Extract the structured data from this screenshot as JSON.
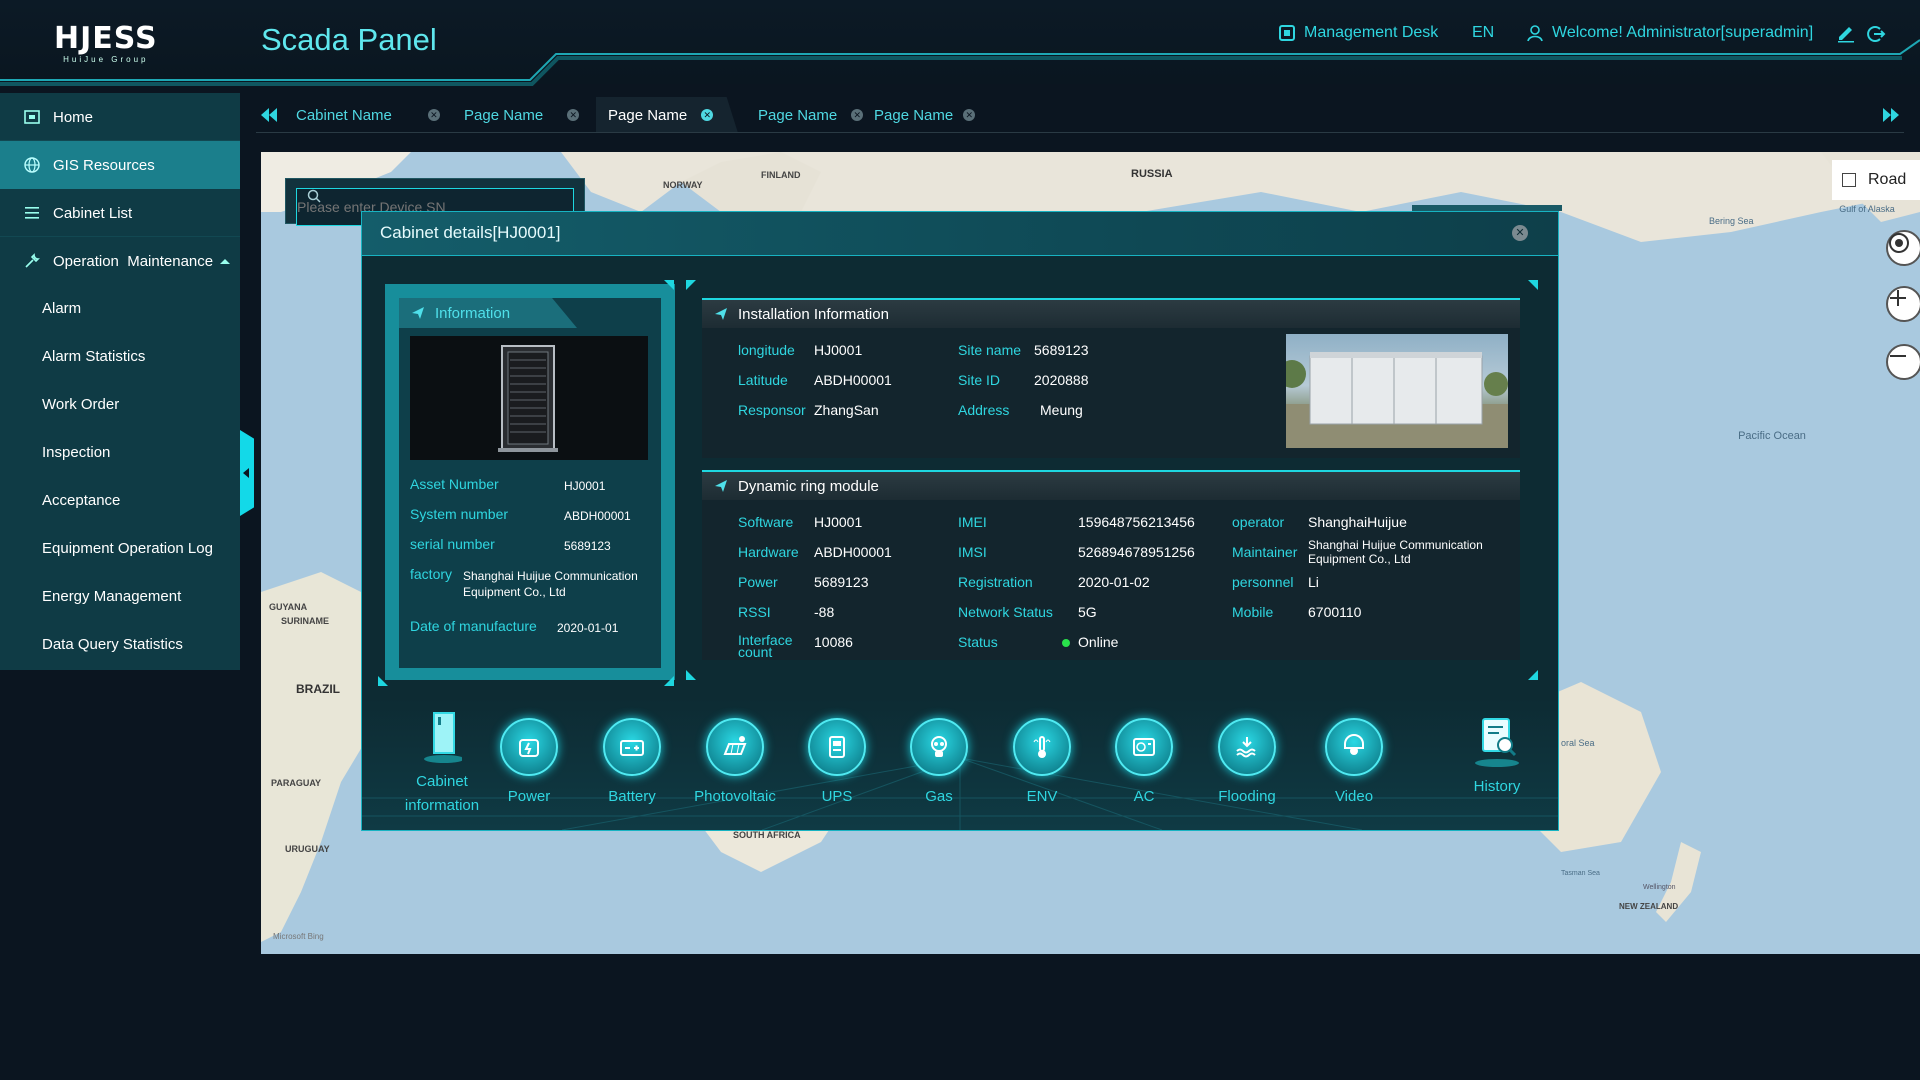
{
  "header": {
    "logo": "HJESS",
    "logo_sub": "HuiJue Group",
    "title": "Scada Panel",
    "management": "Management Desk",
    "lang": "EN",
    "welcome": "Welcome! Administrator[superadmin]"
  },
  "sidebar": {
    "items": [
      {
        "label": "Home",
        "icon": "home-icon"
      },
      {
        "label": "GIS Resources",
        "icon": "globe-icon"
      },
      {
        "label": "Cabinet List",
        "icon": "list-icon"
      },
      {
        "label": "Operation  Maintenance",
        "icon": "wrench-icon"
      }
    ],
    "sub_items": [
      "Alarm",
      "Alarm Statistics",
      "Work Order",
      "Inspection",
      "Acceptance",
      "Equipment Operation Log",
      "Energy Management",
      "Data Query Statistics"
    ]
  },
  "tabs": [
    {
      "label": "Cabinet Name",
      "active": false
    },
    {
      "label": "Page Name",
      "active": false
    },
    {
      "label": "Page Name",
      "active": true
    },
    {
      "label": "Page Name",
      "active": false
    },
    {
      "label": "Page Name",
      "active": false
    }
  ],
  "map": {
    "search_placeholder": "Please enter Device SN",
    "road_label": "Road",
    "labels": {
      "russia": "RUSSIA",
      "finland": "FINLAND",
      "norway": "NORWAY",
      "bering": "Bering Sea",
      "alaska": "Gulf of Alaska",
      "pacific": "Pacific Ocean",
      "guyana": "GUYANA",
      "suriname": "SURINAME",
      "brazil": "BRAZIL",
      "paraguay": "PARAGUAY",
      "uruguay": "URUGUAY",
      "south_africa": "SOUTH AFRICA",
      "coral": "oral Sea",
      "tasman": "Tasman Sea",
      "wellington": "Wellington",
      "nz": "NEW ZEALAND",
      "bing": "Microsoft Bing"
    }
  },
  "dialog": {
    "title": "Cabinet details[HJ0001]",
    "info": {
      "tab": "Information",
      "rows": [
        {
          "label": "Asset Number",
          "value": "HJ0001"
        },
        {
          "label": "System number",
          "value": "ABDH00001"
        },
        {
          "label": "serial number",
          "value": "5689123"
        },
        {
          "label": "factory",
          "value": "Shanghai Huijue Communication Equipment Co., Ltd"
        },
        {
          "label": "Date of manufacture",
          "value": "2020-01-01"
        }
      ]
    },
    "installation": {
      "title": "Installation Information",
      "fields": {
        "longitude_label": "longitude",
        "longitude": "HJ0001",
        "latitude_label": "Latitude",
        "latitude": "ABDH00001",
        "responsor_label": "Responsor",
        "responsor": "ZhangSan",
        "site_name_label": "Site name",
        "site_name": "5689123",
        "site_id_label": "Site ID",
        "site_id": "2020888",
        "address_label": "Address",
        "address": "Meung"
      }
    },
    "ring": {
      "title": "Dynamic ring module",
      "fields": {
        "software_label": "Software",
        "software": "HJ0001",
        "hardware_label": "Hardware",
        "hardware": "ABDH00001",
        "power_label": "Power",
        "power": "5689123",
        "rssi_label": "RSSI",
        "rssi": "-88",
        "interface_label": "Interface count",
        "interface": "10086",
        "imei_label": "IMEI",
        "imei": "159648756213456",
        "imsi_label": "IMSI",
        "imsi": "526894678951256",
        "registration_label": "Registration",
        "registration": "2020-01-02",
        "network_label": "Network Status",
        "network": "5G",
        "status_label": "Status",
        "status": "Online",
        "operator_label": "operator",
        "operator": "ShanghaiHuijue",
        "maintainer_label": "Maintainer",
        "maintainer": "Shanghai Huijue Communication Equipment Co., Ltd",
        "personnel_label": "personnel",
        "personnel": "Li",
        "mobile_label": "Mobile",
        "mobile": "6700110"
      }
    },
    "icons": [
      {
        "label": "Cabinet information",
        "icon": "cabinet-icon"
      },
      {
        "label": "Power",
        "icon": "power-icon"
      },
      {
        "label": "Battery",
        "icon": "battery-icon"
      },
      {
        "label": "Photovoltaic",
        "icon": "solar-icon"
      },
      {
        "label": "UPS",
        "icon": "ups-icon"
      },
      {
        "label": "Gas",
        "icon": "gas-mask-icon"
      },
      {
        "label": "ENV",
        "icon": "thermometer-icon"
      },
      {
        "label": "AC",
        "icon": "ac-icon"
      },
      {
        "label": "Flooding",
        "icon": "flood-icon"
      },
      {
        "label": "Video",
        "icon": "camera-icon"
      },
      {
        "label": "History",
        "icon": "history-icon"
      }
    ]
  },
  "colors": {
    "accent": "#2fd6e0",
    "sidebar": "#0f3b45",
    "active": "#1b7f8c",
    "online": "#29e34b"
  }
}
